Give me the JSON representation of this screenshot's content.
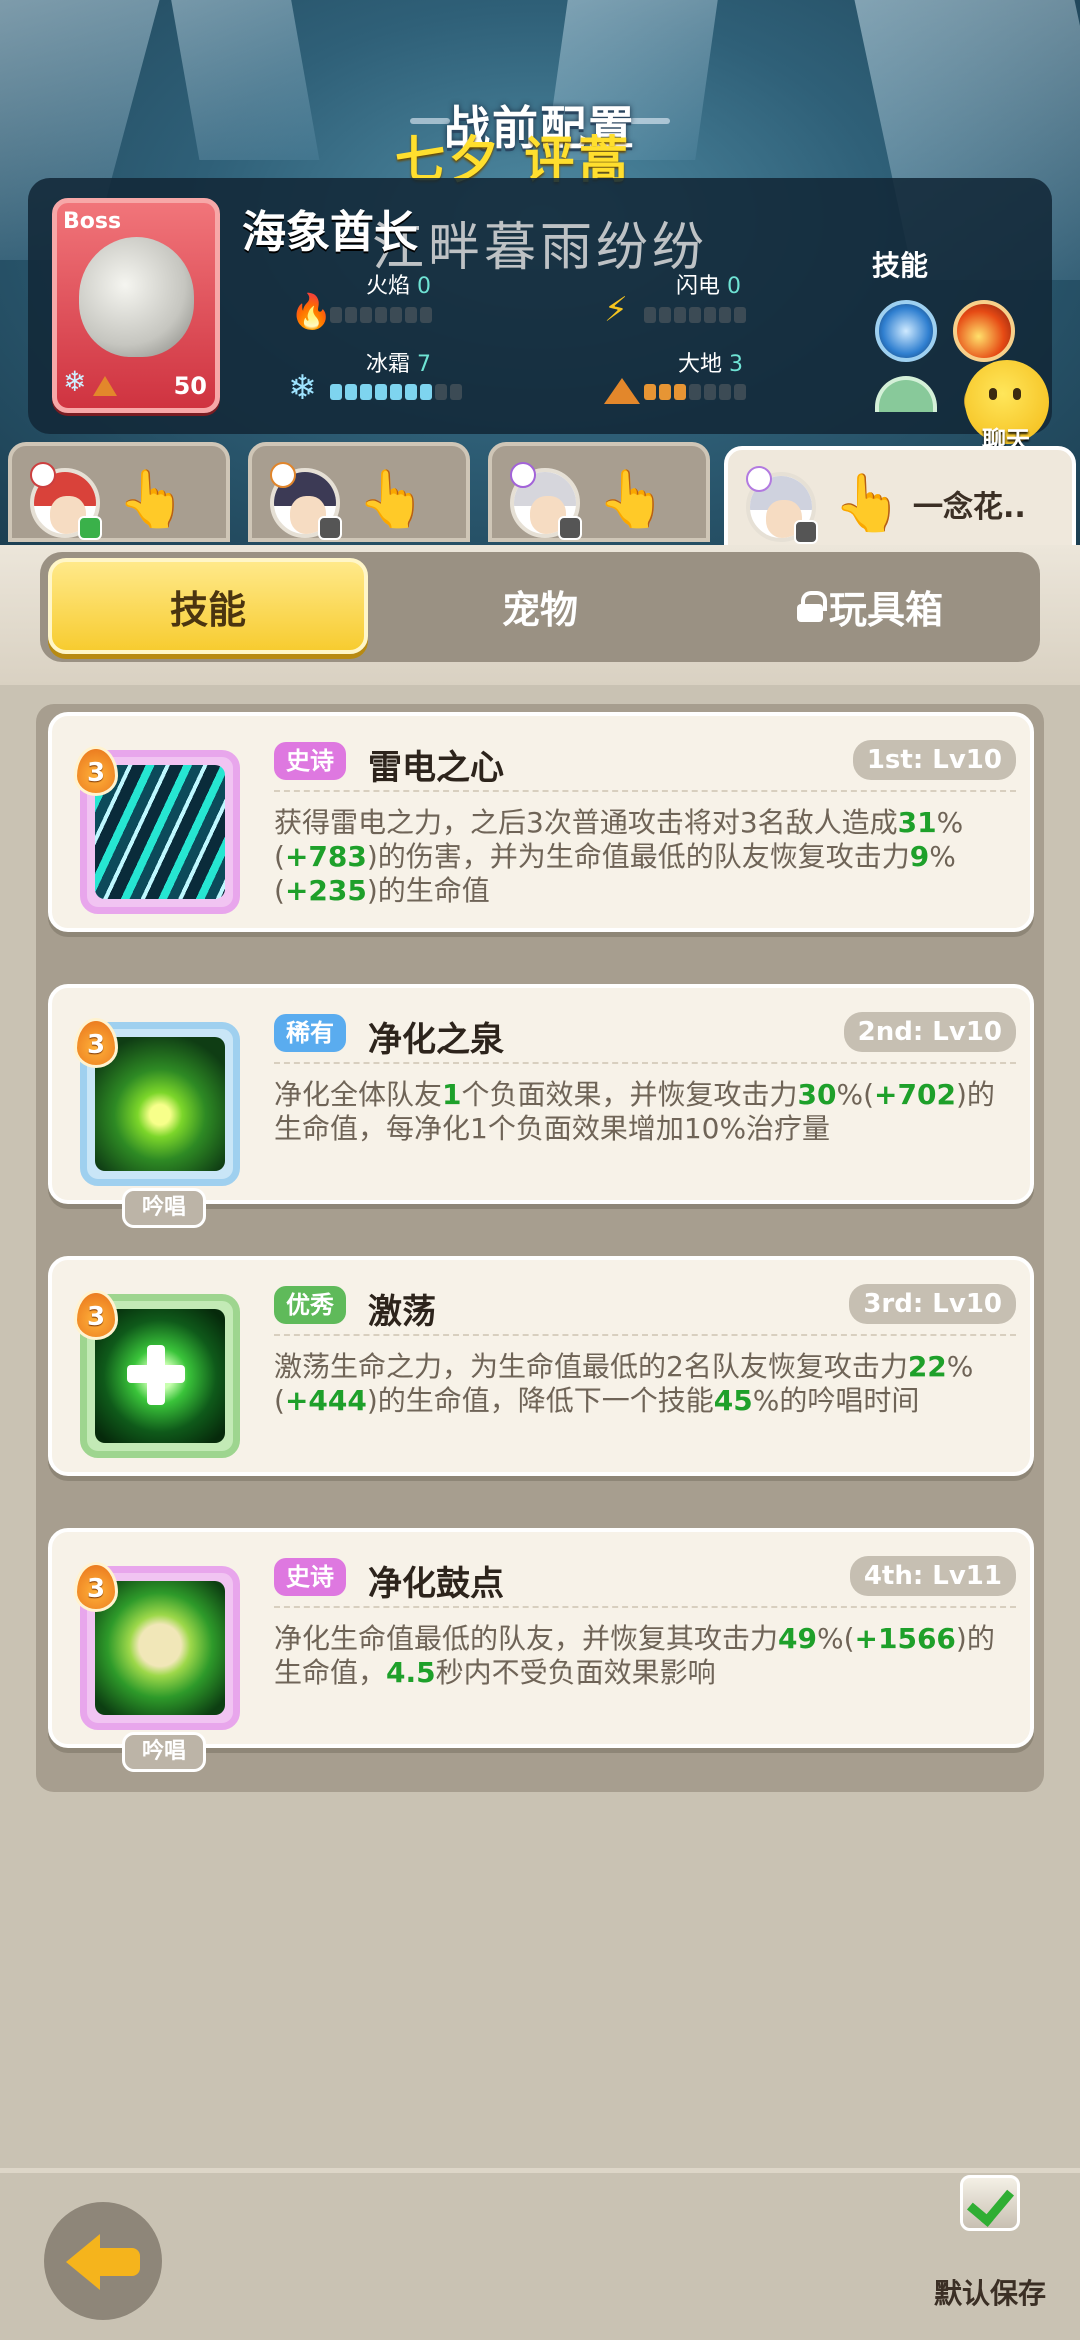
{
  "screen_title": "战前配置",
  "danmaku": {
    "line1": "七夕 评蒿",
    "line2": "江畔暮雨纷纷"
  },
  "boss": {
    "tag": "Boss",
    "name": "海象酋长",
    "level": "50",
    "elements": {
      "fire": {
        "label": "火焰",
        "value": "0"
      },
      "lightning": {
        "label": "闪电",
        "value": "0"
      },
      "frost": {
        "label": "冰霜",
        "value": "7"
      },
      "earth": {
        "label": "大地",
        "value": "3"
      }
    },
    "skills_label": "技能"
  },
  "chat_label": "聊天",
  "party_tabs": [
    {
      "name": ""
    },
    {
      "name": ""
    },
    {
      "name": ""
    },
    {
      "name": "一念花.."
    }
  ],
  "tabs": {
    "skills": "技能",
    "pets": "宠物",
    "toybox": "玩具箱"
  },
  "skills": [
    {
      "rarity": "史诗",
      "name": "雷电之心",
      "slot": "1st: Lv10",
      "level": "3",
      "chant": "",
      "desc": [
        {
          "t": "获得雷电之力，之后3次普通攻击将对3名敌人造成"
        },
        {
          "t": "31",
          "h": 1
        },
        {
          "t": "%("
        },
        {
          "t": "+783",
          "h": 1
        },
        {
          "t": ")的伤害，并为生命值最低的队友恢复攻击力"
        },
        {
          "t": "9",
          "h": 1
        },
        {
          "t": "%("
        },
        {
          "t": "+235",
          "h": 1
        },
        {
          "t": ")的生命值"
        }
      ]
    },
    {
      "rarity": "稀有",
      "name": "净化之泉",
      "slot": "2nd: Lv10",
      "level": "3",
      "chant": "吟唱",
      "desc": [
        {
          "t": "净化全体队友"
        },
        {
          "t": "1",
          "h": 1
        },
        {
          "t": "个负面效果，并恢复攻击力"
        },
        {
          "t": "30",
          "h": 1
        },
        {
          "t": "%("
        },
        {
          "t": "+702",
          "h": 1
        },
        {
          "t": ")的生命值，每净化1个负面效果增加10%治疗量"
        }
      ]
    },
    {
      "rarity": "优秀",
      "name": "激荡",
      "slot": "3rd: Lv10",
      "level": "3",
      "chant": "",
      "desc": [
        {
          "t": "激荡生命之力，为生命值最低的2名队友恢复攻击力"
        },
        {
          "t": "22",
          "h": 1
        },
        {
          "t": "%("
        },
        {
          "t": "+444",
          "h": 1
        },
        {
          "t": ")的生命值，降低下一个技能"
        },
        {
          "t": "45",
          "h": 1
        },
        {
          "t": "%的吟唱时间"
        }
      ]
    },
    {
      "rarity": "史诗",
      "name": "净化鼓点",
      "slot": "4th: Lv11",
      "level": "3",
      "chant": "吟唱",
      "desc": [
        {
          "t": "净化生命值最低的队友，并恢复其攻击力"
        },
        {
          "t": "49",
          "h": 1
        },
        {
          "t": "%("
        },
        {
          "t": "+1566",
          "h": 1
        },
        {
          "t": ")的生命值，"
        },
        {
          "t": "4.5",
          "h": 1
        },
        {
          "t": "秒内不受负面效果影响"
        }
      ]
    }
  ],
  "footer": {
    "save_label": "默认保存"
  },
  "colors": {
    "accent_yellow": "#f7cc30",
    "highlight_green": "#1ea02a",
    "epic": "#de78e0",
    "rare": "#5aacef",
    "good": "#5fba5a"
  }
}
